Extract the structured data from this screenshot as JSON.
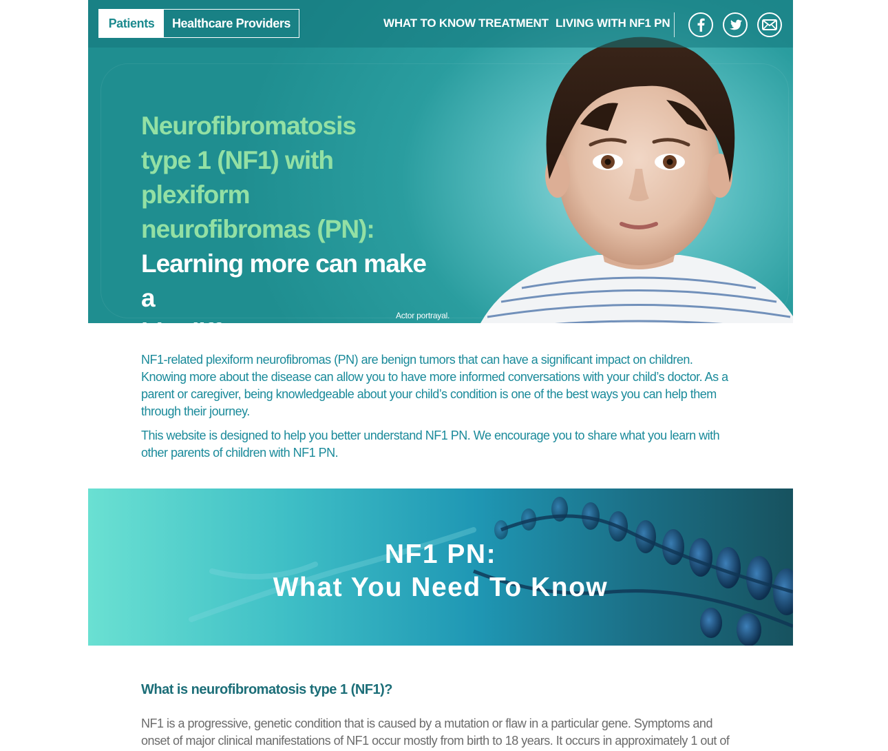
{
  "audience": {
    "patients_label": "Patients",
    "providers_label": "Healthcare Providers"
  },
  "nav": {
    "what_to_know": "WHAT TO KNOW",
    "treatment": "TREATMENT",
    "living": "LIVING WITH NF1 PN"
  },
  "social": {
    "facebook_icon": "facebook-icon",
    "twitter_icon": "twitter-icon",
    "email_icon": "email-icon"
  },
  "hero": {
    "headline_green_1": "Neurofibromatosis",
    "headline_green_2": "type 1 (NF1) with plexiform",
    "headline_green_3": "neurofibromas (PN):",
    "headline_white_1": "Learning more can make a",
    "headline_white_2": "big difference",
    "actor_note": "Actor portrayal."
  },
  "intro": {
    "paragraph_1": "NF1-related plexiform neurofibromas (PN) are benign tumors that can have a significant impact on children. Knowing more about the disease can allow you to have more informed conversations with your child’s doctor. As a parent or caregiver, being knowledgeable about your child’s condition is one of the best ways you can help them through their journey.",
    "paragraph_2": "This website is designed to help you better understand NF1 PN. We encourage you to share what you learn with other parents of children with NF1 PN."
  },
  "banner": {
    "title_line_1": "NF1 PN:",
    "title_line_2": "What You Need To Know"
  },
  "section": {
    "heading": "What is neurofibromatosis type 1 (NF1)?",
    "body": "NF1 is a progressive, genetic condition that is caused by a mutation or flaw in a particular gene. Symptoms and onset of major clinical manifestations of NF1 occur mostly from birth to 18 years. It occurs in approximately 1 out of"
  },
  "colors": {
    "teal_dark": "#1f8e90",
    "headline_green": "#93e0a4",
    "intro_text": "#1a8a9a",
    "section_heading": "#1c6e78"
  }
}
